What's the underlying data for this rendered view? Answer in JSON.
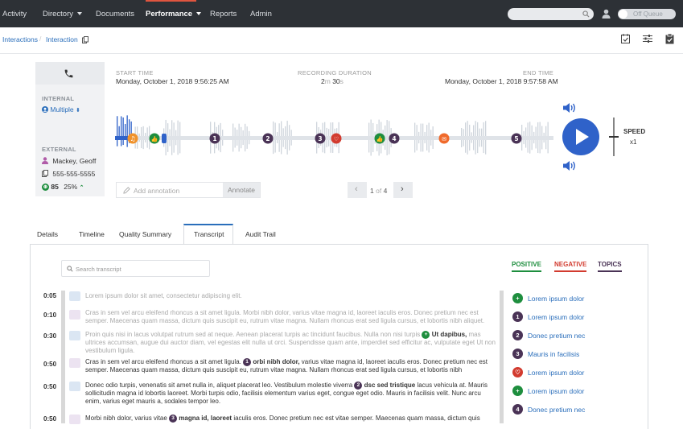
{
  "nav": {
    "items": [
      "Activity",
      "Directory",
      "Documents",
      "Performance",
      "Reports",
      "Admin"
    ],
    "queue_toggle": "Off Queue"
  },
  "breadcrumb": [
    "Interactions",
    "Interaction"
  ],
  "call": {
    "internal_label": "INTERNAL",
    "internal_value": "Multiple",
    "external_label": "EXTERNAL",
    "external_name": "Mackey, Geoff",
    "external_phone": "555-555-5555",
    "score": "85",
    "score_pct": "25%"
  },
  "recording": {
    "start_label": "START TIME",
    "start_value": "Monday, October 1, 2018 9:56:25 AM",
    "duration_label": "RECORDING DURATION",
    "duration_min": "2",
    "duration_m": "m",
    "duration_sec": "30",
    "duration_s": "s",
    "end_label": "END TIME",
    "end_value": "Monday, October 1, 2018 9:57:58 AM",
    "speed_label": "SPEED",
    "speed_value": "x1",
    "markers": [
      "1",
      "2",
      "3",
      "4",
      "5"
    ]
  },
  "annotation": {
    "placeholder": "Add annotation",
    "button": "Annotate"
  },
  "pager": {
    "current": "1",
    "of": "of",
    "total": "4"
  },
  "tabs": [
    "Details",
    "Timeline",
    "Quality Summary",
    "Transcript",
    "Audit Trail"
  ],
  "transcript": {
    "search_placeholder": "Search transcript",
    "filters": [
      "POSITIVE",
      "NEGATIVE",
      "TOPICS"
    ],
    "lines": [
      {
        "time": "0:05",
        "text": "Lorem ipsum dolor sit amet, consectetur adipiscing elit."
      },
      {
        "time": "0:10",
        "text": "Cras in sem vel arcu eleifend rhoncus a sit amet ligula. Morbi nibh dolor, varius vitae magna id, laoreet iaculis eros. Donec pretium nec est semper. Maecenas quam massa, dictum quis suscipit eu, rutrum vitae magna. Nullam rhoncus erat sed ligula cursus, et lobortis nibh aliquet."
      },
      {
        "time": "0:30",
        "text_a": "Proin quis nisi in lacus volutpat rutrum sed at neque. Aenean placerat turpis ac tincidunt faucibus. Nulla non nisi turpis",
        "hl": "Ut dapibus,",
        "text_b": "mas ultrices accumsan, augue dui auctor diam, vel egestas elit nulla ut orci. Suspendisse quam ante, imperdiet sed efficitur ac, vulputate eget Ut non vestibulum ligula."
      },
      {
        "time": "0:50",
        "text_a": "Cras in sem vel arcu eleifend rhoncus a sit amet ligula.",
        "hl": "orbi nibh dolor,",
        "text_b": "varius vitae magna id, laoreet iaculis eros. Donec pretium nec est semper. Maecenas quam massa, dictum quis suscipit eu, rutrum vitae magna. Nullam rhoncus erat sed ligula cursus, et lobortis nibh"
      },
      {
        "time": "0:50",
        "text_a": "Donec odio turpis, venenatis sit amet nulla in, aliquet placerat leo. Vestibulum molestie viverra",
        "hl": "dsc sed tristique",
        "text_b": "lacus vehicula at. Mauris sollicitudin magna id lobortis laoreet. Morbi turpis odio, facilisis elementum varius eget, congue eget odio. Mauris in facilisis velit. Nunc arcu enim, varius eget mauris a, sodales tempor leo."
      },
      {
        "time": "0:50",
        "text_a": "Morbi nibh dolor, varius vitae",
        "hl": "magna id, laoreet",
        "text_b": "iaculis eros. Donec pretium nec est vitae semper. Maecenas quam massa, dictum quis"
      }
    ],
    "sidebar": [
      {
        "mark": "",
        "color": "#1e8e3e",
        "text": "Lorem ipsum dolor"
      },
      {
        "mark": "1",
        "color": "#4a3356",
        "text": "Lorem ipsum dolor"
      },
      {
        "mark": "2",
        "color": "#4a3356",
        "text": "Donec pretium nec"
      },
      {
        "mark": "3",
        "color": "#4a3356",
        "text": "Mauris in facilisis"
      },
      {
        "mark": "",
        "color": "#d23b2f",
        "text": "Lorem ipsum dolor"
      },
      {
        "mark": "",
        "color": "#1e8e3e",
        "text": "Lorem ipsum dolor"
      },
      {
        "mark": "4",
        "color": "#4a3356",
        "text": "Donec pretium nec"
      }
    ]
  },
  "colors": {
    "positive": "#1e8e3e",
    "negative": "#d23b2f",
    "topics": "#4a3356",
    "accent": "#2a6ebb",
    "play": "#2f62c9",
    "nav": "#2d3136"
  }
}
